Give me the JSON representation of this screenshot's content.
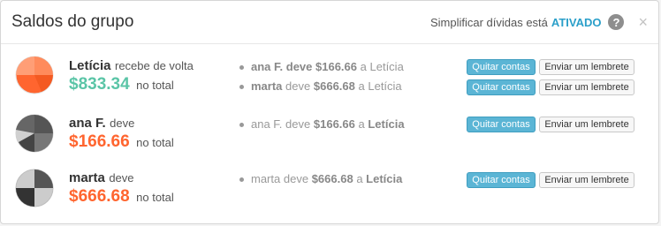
{
  "header": {
    "title": "Saldos do grupo",
    "simplify_label": "Simplificar dívidas está",
    "simplify_status": "ATIVADO",
    "help_label": "?",
    "close_label": "×"
  },
  "buttons": {
    "settle_label": "Quitar contas",
    "remind_label": "Enviar um lembrete"
  },
  "balances": [
    {
      "name": "Letícia",
      "verb": "recebe de volta",
      "amount": "$833.34",
      "total_label": "no total",
      "status": "positive",
      "debts": [
        {
          "from": "ana F.",
          "verb": "deve",
          "amount": "$166.66",
          "prep": "a",
          "to": "Letícia"
        },
        {
          "from": "marta",
          "verb": "deve",
          "amount": "$666.68",
          "prep": "a",
          "to": "Letícia"
        }
      ]
    },
    {
      "name": "ana F.",
      "verb": "deve",
      "amount": "$166.66",
      "total_label": "no total",
      "status": "negative",
      "debts": [
        {
          "from": "ana F.",
          "verb": "deve",
          "amount": "$166.66",
          "prep": "a",
          "to": "Letícia"
        }
      ]
    },
    {
      "name": "marta",
      "verb": "deve",
      "amount": "$666.68",
      "total_label": "no total",
      "status": "negative",
      "debts": [
        {
          "from": "marta",
          "verb": "deve",
          "amount": "$666.68",
          "prep": "a",
          "to": "Letícia"
        }
      ]
    }
  ],
  "colors": {
    "positive": "#5bc5a7",
    "negative": "#ff652f",
    "accent": "#2a9fc9",
    "settle_button": "#5bb5d5"
  }
}
